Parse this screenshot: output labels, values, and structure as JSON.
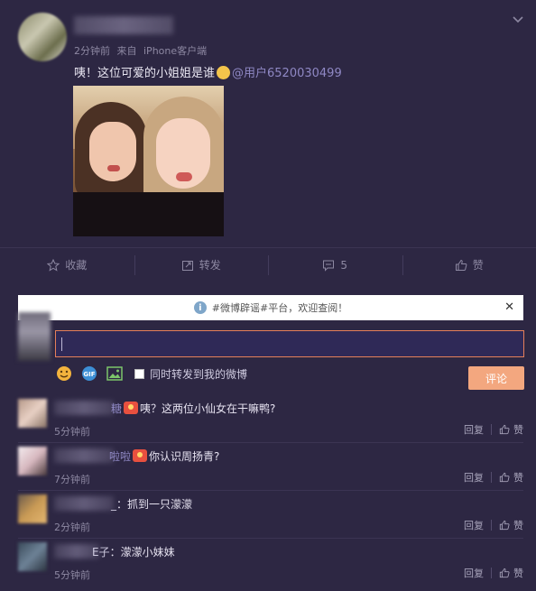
{
  "post": {
    "time": "2分钟前",
    "source_prefix": "来自",
    "source": "iPhone客户端",
    "text": "咦！这位可爱的小姐姐是谁",
    "mention": "@用户6520030499"
  },
  "actions": {
    "favorite": "收藏",
    "repost": "转发",
    "comment_count": "5",
    "like": "赞"
  },
  "tip": {
    "text": "#微博辟谣#平台，欢迎查阅！",
    "close": "✕"
  },
  "composer": {
    "value": "",
    "sync_label": "同时转发到我的微博",
    "submit": "评论"
  },
  "comments": [
    {
      "name_end": "糖",
      "text": "咦？这两位小仙女在干嘛鸭?",
      "time": "5分钟前",
      "reply": "回复",
      "like": "赞"
    },
    {
      "name_end": "啦啦",
      "text": "你认识周扬青?",
      "time": "7分钟前",
      "reply": "回复",
      "like": "赞"
    },
    {
      "name_end": "_",
      "text": "：抓到一只濛濛",
      "time": "2分钟前",
      "reply": "回复",
      "like": "赞"
    },
    {
      "name_end": "E子",
      "text": "：濛濛小妹妹",
      "time": "5分钟前",
      "reply": "回复",
      "like": "赞"
    }
  ]
}
